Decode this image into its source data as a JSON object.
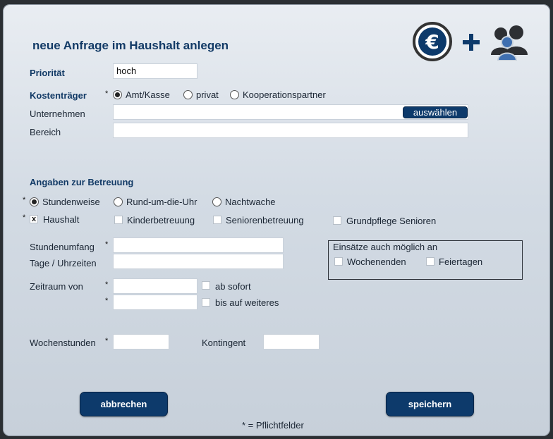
{
  "dialog": {
    "title": "neue Anfrage im Haushalt anlegen",
    "header_icons": [
      "euro-icon",
      "plus-icon",
      "people-group-icon"
    ],
    "accent_color": "#0d3a6b"
  },
  "priority": {
    "label": "Priorität",
    "value": "hoch"
  },
  "payer": {
    "label": "Kostenträger",
    "required_mark": "*",
    "options": [
      "Amt/Kasse",
      "privat",
      "Kooperationspartner"
    ],
    "selected": "Amt/Kasse"
  },
  "company": {
    "label": "Unternehmen",
    "value": "",
    "select_button": "auswählen"
  },
  "area": {
    "label": "Bereich",
    "value": ""
  },
  "care": {
    "section_title": "Angaben zur Betreuung",
    "required_mark": "*",
    "modes": [
      "Stundenweise",
      "Rund-um-die-Uhr",
      "Nachtwache"
    ],
    "selected_mode": "Stundenweise",
    "types": [
      {
        "label": "Haushalt",
        "checked": true
      },
      {
        "label": "Kinderbetreuung",
        "checked": false
      },
      {
        "label": "Seniorenbetreuung",
        "checked": false
      },
      {
        "label": "Grundpflege Senioren",
        "checked": false
      }
    ],
    "checked_mark": "x"
  },
  "hours_scope": {
    "label": "Stundenumfang",
    "required_mark": "*",
    "value": ""
  },
  "days_times": {
    "label": "Tage / Uhrzeiten",
    "value": ""
  },
  "assignments": {
    "title": "Einsätze auch möglich an",
    "options": [
      "Wochenenden",
      "Feiertagen"
    ]
  },
  "period": {
    "label": "Zeitraum von",
    "required_mark": "*",
    "from_value": "",
    "to_value": "",
    "from_option": "ab sofort",
    "to_option": "bis auf weiteres"
  },
  "weekly_hours": {
    "label": "Wochenstunden",
    "required_mark": "*",
    "value": ""
  },
  "quota": {
    "label": "Kontingent",
    "value": ""
  },
  "buttons": {
    "cancel": "abbrechen",
    "save": "speichern"
  },
  "footnote": "* = Pflichtfelder"
}
